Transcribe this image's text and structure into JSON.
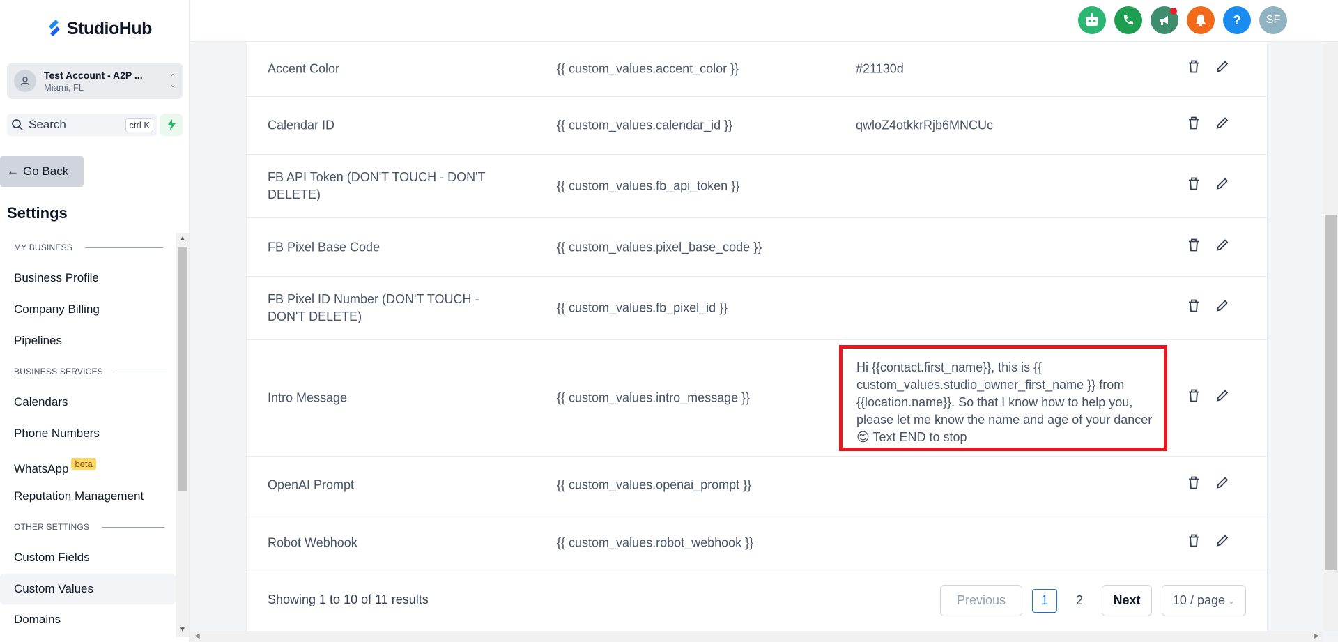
{
  "brand": {
    "name": "StudioHub"
  },
  "account": {
    "name": "Test Account - A2P ...",
    "location": "Miami, FL"
  },
  "search": {
    "label": "Search",
    "shortcut": "ctrl K"
  },
  "nav": {
    "go_back": "Go Back",
    "settings_title": "Settings",
    "sections": {
      "my_business": "MY BUSINESS",
      "business_services": "BUSINESS SERVICES",
      "other_settings": "OTHER SETTINGS"
    },
    "items": {
      "business_profile": "Business Profile",
      "company_billing": "Company Billing",
      "pipelines": "Pipelines",
      "calendars": "Calendars",
      "phone_numbers": "Phone Numbers",
      "whatsapp": "WhatsApp",
      "whatsapp_badge": "beta",
      "reputation_management": "Reputation Management",
      "custom_fields": "Custom Fields",
      "custom_values": "Custom Values",
      "domains": "Domains"
    }
  },
  "topbar": {
    "avatar_initials": "SF",
    "help_label": "?"
  },
  "rows": [
    {
      "name": "Accent Color",
      "key": "{{ custom_values.accent_color }}",
      "value": "#21130d"
    },
    {
      "name": "Calendar ID",
      "key": "{{ custom_values.calendar_id }}",
      "value": "qwloZ4otkkrRjb6MNCUc"
    },
    {
      "name": "FB API Token (DON'T TOUCH - DON'T DELETE)",
      "key": "{{ custom_values.fb_api_token }}",
      "value": ""
    },
    {
      "name": "FB Pixel Base Code",
      "key": "{{ custom_values.pixel_base_code }}",
      "value": ""
    },
    {
      "name": "FB Pixel ID Number (DON'T TOUCH - DON'T DELETE)",
      "key": "{{ custom_values.fb_pixel_id }}",
      "value": ""
    },
    {
      "name": "Intro Message",
      "key": "{{ custom_values.intro_message }}",
      "value": "Hi {{contact.first_name}}, this is {{ custom_values.studio_owner_first_name }} from {{location.name}}. So that I know how to help you, please let me know the name and age of your dancer 😊 Text END to stop"
    },
    {
      "name": "OpenAI Prompt",
      "key": "{{ custom_values.openai_prompt }}",
      "value": ""
    },
    {
      "name": "Robot Webhook",
      "key": "{{ custom_values.robot_webhook }}",
      "value": ""
    }
  ],
  "pagination": {
    "showing": "Showing 1 to 10 of 11 results",
    "previous": "Previous",
    "pages": [
      "1",
      "2"
    ],
    "next": "Next",
    "page_size": "10 / page"
  },
  "colors": {
    "highlight": "#e21b23",
    "robot_icon": "#2bb673",
    "phone_icon": "#1e9e50",
    "megaphone_icon": "#3e8e6e",
    "bell_icon": "#f26a1b",
    "help_icon": "#1a8cf0",
    "avatar": "#8fb3c0"
  }
}
